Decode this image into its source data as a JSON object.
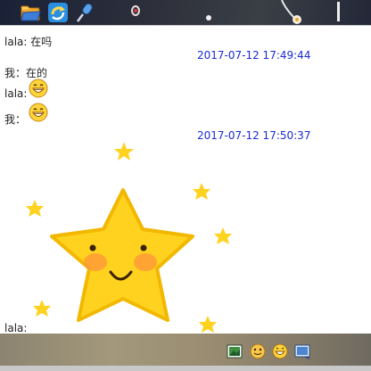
{
  "toolbar": {
    "icons": [
      "folder-icon",
      "refresh-share-icon",
      "microphone-icon"
    ]
  },
  "messages": [
    {
      "sender": "lala:",
      "text": "在吗"
    },
    {
      "timestamp": "2017-07-12 17:49:44"
    },
    {
      "sender": "我：",
      "text": "在的"
    },
    {
      "sender": "lala:",
      "emoji": "grin-emoji"
    },
    {
      "sender": "我：",
      "emoji": "grin-emoji"
    },
    {
      "timestamp": "2017-07-12 17:50:37"
    },
    {
      "sender": "lala:",
      "sticker": "smiling-star-sticker"
    }
  ],
  "bottombar": {
    "icons": [
      "image-icon",
      "sticker-icon",
      "emoji-icon",
      "screenshot-icon"
    ]
  }
}
